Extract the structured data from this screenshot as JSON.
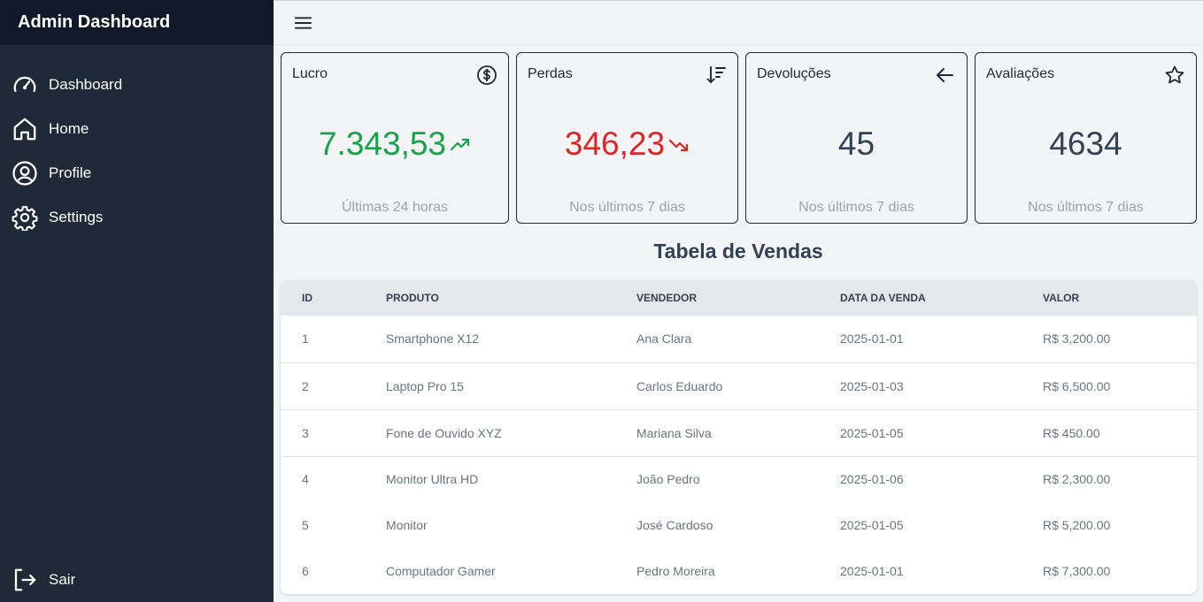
{
  "sidebar": {
    "title": "Admin Dashboard",
    "items": [
      {
        "label": "Dashboard",
        "icon": "gauge-icon"
      },
      {
        "label": "Home",
        "icon": "home-icon"
      },
      {
        "label": "Profile",
        "icon": "user-circle-icon"
      },
      {
        "label": "Settings",
        "icon": "gear-icon"
      }
    ],
    "logout_label": "Sair"
  },
  "topbar": {
    "menu_icon": "hamburger-icon"
  },
  "cards": [
    {
      "title": "Lucro",
      "value": "7.343,53",
      "subtitle": "Últimas 24 horas",
      "icon": "dollar-circle-icon",
      "trend": "up",
      "color": "#16a34a"
    },
    {
      "title": "Perdas",
      "value": "346,23",
      "subtitle": "Nos últimos 7 dias",
      "icon": "sort-descending-icon",
      "trend": "down",
      "color": "#dc2626"
    },
    {
      "title": "Devoluções",
      "value": "45",
      "subtitle": "Nos últimos 7 dias",
      "icon": "arrow-left-icon",
      "color": "#334155"
    },
    {
      "title": "Avaliações",
      "value": "4634",
      "subtitle": "Nos últimos 7 dias",
      "icon": "star-icon",
      "color": "#334155"
    }
  ],
  "table": {
    "title": "Tabela de Vendas",
    "headers": [
      "ID",
      "PRODUTO",
      "VENDEDOR",
      "DATA DA VENDA",
      "VALOR"
    ],
    "rows": [
      [
        "1",
        "Smartphone X12",
        "Ana Clara",
        "2025-01-01",
        "R$ 3,200.00"
      ],
      [
        "2",
        "Laptop Pro 15",
        "Carlos Eduardo",
        "2025-01-03",
        "R$ 6,500.00"
      ],
      [
        "3",
        "Fone de Ouvido XYZ",
        "Mariana Silva",
        "2025-01-05",
        "R$ 450.00"
      ],
      [
        "4",
        "Monitor Ultra HD",
        "João Pedro",
        "2025-01-06",
        "R$ 2,300.00"
      ],
      [
        "5",
        "Monitor",
        "José Cardoso",
        "2025-01-05",
        "R$ 5,200.00"
      ],
      [
        "6",
        "Computador Gamer",
        "Pedro Moreira",
        "2025-01-01",
        "R$ 7,300.00"
      ]
    ]
  }
}
